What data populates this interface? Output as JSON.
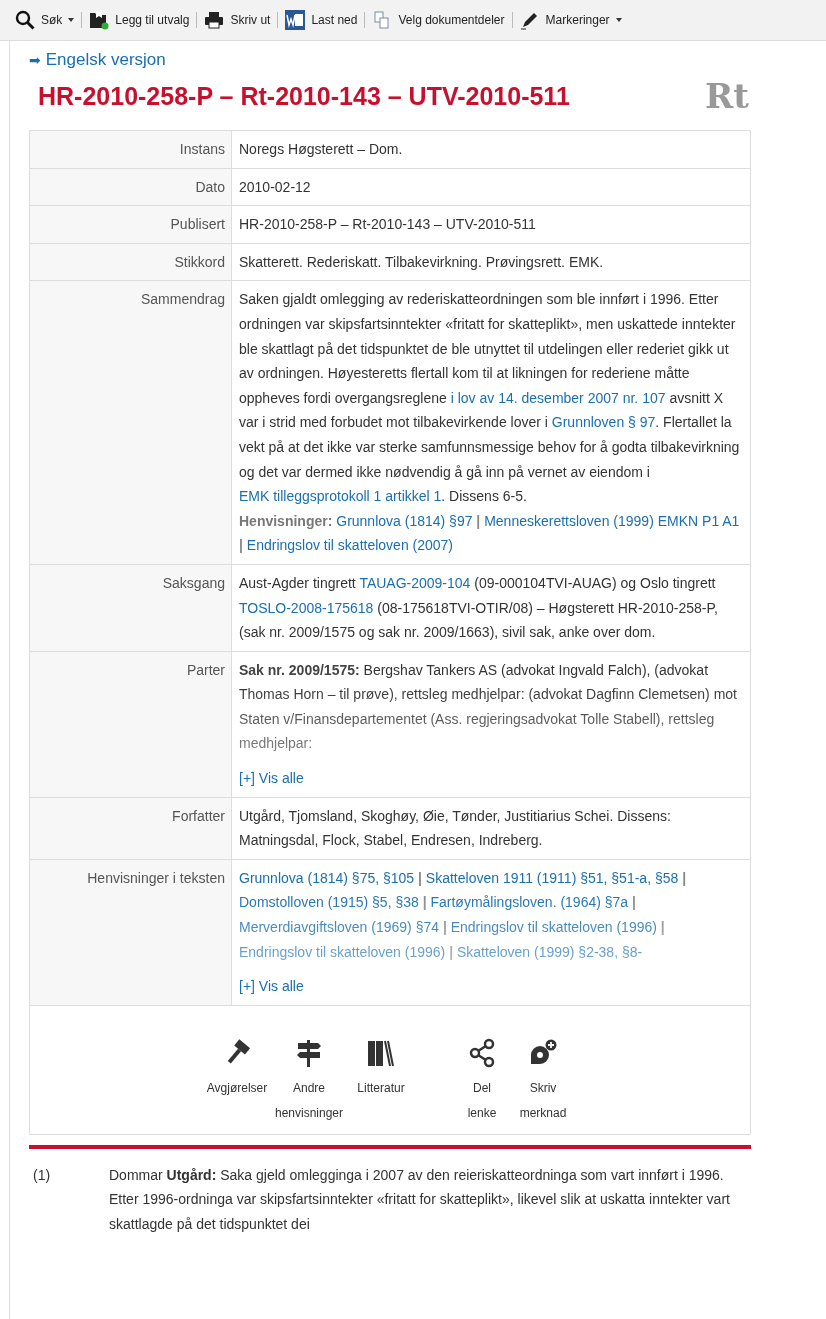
{
  "toolbar": [
    {
      "kind": "search",
      "label": "Søk",
      "dropdown": true
    },
    {
      "kind": "add",
      "label": "Legg til utvalg",
      "dropdown": false
    },
    {
      "kind": "print",
      "label": "Skriv ut",
      "dropdown": false
    },
    {
      "kind": "word",
      "label": "Last ned",
      "dropdown": false
    },
    {
      "kind": "parts",
      "label": "Velg dokumentdeler",
      "dropdown": false
    },
    {
      "kind": "pen",
      "label": "Markeringer",
      "dropdown": true
    }
  ],
  "english_link": {
    "icon": "➡",
    "label": "Engelsk versjon"
  },
  "title": "HR-2010-258-P – Rt-2010-143 – UTV-2010-511",
  "logo": "Rt",
  "rows": [
    {
      "label": "Instans",
      "content": [
        {
          "kind": "text",
          "text": "Noregs Høgsterett – Dom."
        }
      ]
    },
    {
      "label": "Dato",
      "content": [
        {
          "kind": "text",
          "text": "2010-02-12"
        }
      ]
    },
    {
      "label": "Publisert",
      "content": [
        {
          "kind": "text",
          "text": "HR-2010-258-P – Rt-2010-143 – UTV-2010-511"
        }
      ]
    },
    {
      "label": "Stikkord",
      "content": [
        {
          "kind": "text",
          "text": "Skatterett. Rederiskatt. Tilbakevirkning. Prøvingsrett. EMK."
        }
      ]
    },
    {
      "label": "Sammendrag",
      "content": [
        {
          "kind": "text",
          "text": "Saken gjaldt omlegging av rederiskatteordningen som ble innført i 1996. Etter ordningen var skipsfartsinntekter «fritatt for skatteplikt», men uskattede inntekter ble skattlagt på det tidspunktet de ble utnyttet til utdelingen eller rederiet gikk ut av ordningen. Høyesteretts flertall kom til at likningen for rederiene måtte oppheves fordi overgangsreglene"
        },
        {
          "kind": "link",
          "text": "i lov av 14. desember 2007 nr. 107"
        },
        {
          "kind": "text",
          "text": "avsnitt X var i strid med forbudet mot tilbakevirkende lover i"
        },
        {
          "kind": "link",
          "text": "Grunnloven § 97"
        },
        {
          "kind": "text",
          "text": ". Flertallet la vekt på at det ikke var sterke samfunnsmessige behov for å godta tilbakevirkning og det var dermed ikke nødvendig å gå inn på vernet av eiendom i"
        },
        {
          "kind": "link",
          "text": "EMK tilleggsprotokoll 1 artikkel 1"
        },
        {
          "kind": "text",
          "text": ". Dissens 6-5."
        },
        {
          "kind": "break"
        },
        {
          "kind": "label",
          "text": "Henvisninger:"
        },
        {
          "kind": "link",
          "text": "Grunnlova (1814) §97"
        },
        {
          "kind": "sep",
          "text": "|"
        },
        {
          "kind": "link",
          "text": "Menneskerettsloven (1999)"
        },
        {
          "kind": "link",
          "text": "EMKN P1 A1"
        },
        {
          "kind": "sep",
          "text": "|"
        },
        {
          "kind": "link",
          "text": "Endringslov til skatteloven (2007)"
        }
      ]
    },
    {
      "label": "Saksgang",
      "content": [
        {
          "kind": "text",
          "text": "Aust-Agder tingrett"
        },
        {
          "kind": "link",
          "text": "TAUAG-2009-104"
        },
        {
          "kind": "text",
          "text": "(09-000104TVI-AUAG) og Oslo tingrett"
        },
        {
          "kind": "link",
          "text": "TOSLO-2008-175618"
        },
        {
          "kind": "text",
          "text": "(08-175618TVI-OTIR/08) – Høgsterett HR-2010-258-P, (sak nr. 2009/1575 og sak nr. 2009/1663), sivil sak, anke over dom."
        }
      ]
    },
    {
      "label": "Parter",
      "more": "[+] Vis alle",
      "content": [
        {
          "kind": "bold",
          "text": "Sak nr. 2009/1575:"
        },
        {
          "kind": "text",
          "text": "Bergshav Tankers AS (advokat Ingvald Falch), (advokat Thomas Horn – til prøve), rettsleg medhjelpar: (advokat Dagfinn Clemetsen) mot Staten v/Finansdepartementet (Ass. regjeringsadvokat Tolle Stabell), rettsleg medhjelpar:"
        }
      ]
    },
    {
      "label": "Forfatter",
      "content": [
        {
          "kind": "text",
          "text": "Utgård, Tjomsland, Skoghøy, Øie, Tønder, Justitiarius Schei. Dissens: Matningsdal, Flock, Stabel, Endresen, Indreberg."
        }
      ]
    },
    {
      "label": "Henvisninger i teksten",
      "more": "[+] Vis alle",
      "content": [
        {
          "kind": "link",
          "text": "Grunnlova (1814) §75, §105"
        },
        {
          "kind": "sep",
          "text": "|"
        },
        {
          "kind": "link",
          "text": "Skatteloven 1911 (1911) §51, §51-a,"
        },
        {
          "kind": "link",
          "text": "§58"
        },
        {
          "kind": "sep",
          "text": "|"
        },
        {
          "kind": "link",
          "text": "Domstolloven (1915) §5, §38"
        },
        {
          "kind": "sep",
          "text": "|"
        },
        {
          "kind": "link",
          "text": "Fartøymålingsloven. (1964) §7a"
        },
        {
          "kind": "sep",
          "text": "|"
        },
        {
          "kind": "link",
          "text": "Merverdiavgiftsloven (1969) §74"
        },
        {
          "kind": "sep",
          "text": "|"
        },
        {
          "kind": "link",
          "text": "Endringslov til skatteloven (1996)"
        },
        {
          "kind": "sep",
          "text": "|"
        },
        {
          "kind": "link",
          "text": "Endringslov til skatteloven (1996)"
        },
        {
          "kind": "sep",
          "text": "|"
        },
        {
          "kind": "link",
          "text": "Skatteloven (1999) §2-38, §8-"
        }
      ]
    }
  ],
  "actions": [
    {
      "kind": "gavel",
      "label": "Avgjørelser"
    },
    {
      "kind": "signpost",
      "label": "Andre henvisninger"
    },
    {
      "kind": "books",
      "label": "Litteratur"
    },
    {
      "kind": "share",
      "label": "Del lenke"
    },
    {
      "kind": "note",
      "label": "Skriv merknad"
    }
  ],
  "paragraphs": [
    {
      "number": "(1)",
      "text": "Dommar **Utgård:** Saka gjeld omlegginga i 2007 av den reieriskatteordninga som vart innført i 1996. Etter 1996-ordninga var skipsfartsinntekter «fritatt for skatteplikt», likevel slik at uskatta inntekter vart skattlagde på det tidspunktet dei"
    }
  ]
}
